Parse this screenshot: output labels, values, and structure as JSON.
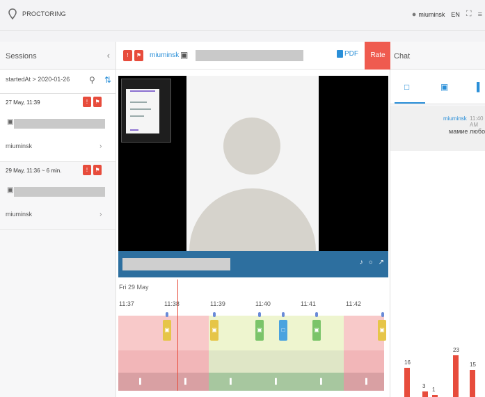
{
  "topbar": {
    "brand": "PROCTORING",
    "username": "miuminsk",
    "lang": "EN"
  },
  "sessions": {
    "title": "Sessions",
    "search_value": "startedAt > 2020-01-26",
    "items": [
      {
        "time": "27 May, 11:39",
        "user": "miuminsk"
      },
      {
        "time": "29 May, 11:36 ~ 6 min.",
        "user": "miuminsk"
      }
    ]
  },
  "main": {
    "username": "miuminsk",
    "pdf_label": "PDF",
    "rate_label": "Rate"
  },
  "timeline": {
    "date": "Fri 29 May",
    "ticks": [
      "11:37",
      "11:38",
      "11:39",
      "11:40",
      "11:41",
      "11:42"
    ]
  },
  "chat": {
    "title": "Chat",
    "message": {
      "user": "miuminsk",
      "time": "11:40 AM",
      "text": "мамие любо"
    },
    "stats": [
      {
        "label": "16",
        "value": 16
      },
      {
        "label": "3",
        "value": 3
      },
      {
        "label": "1",
        "value": 1
      },
      {
        "label": "23",
        "value": 23
      },
      {
        "label": "15",
        "value": 15
      }
    ]
  },
  "colors": {
    "accent": "#2a8fd8",
    "danger": "#e74c3c",
    "rate": "#ef5b4f",
    "marker_yellow": "#e6c548",
    "marker_green": "#7bc46a",
    "marker_blue": "#4aa3df"
  }
}
